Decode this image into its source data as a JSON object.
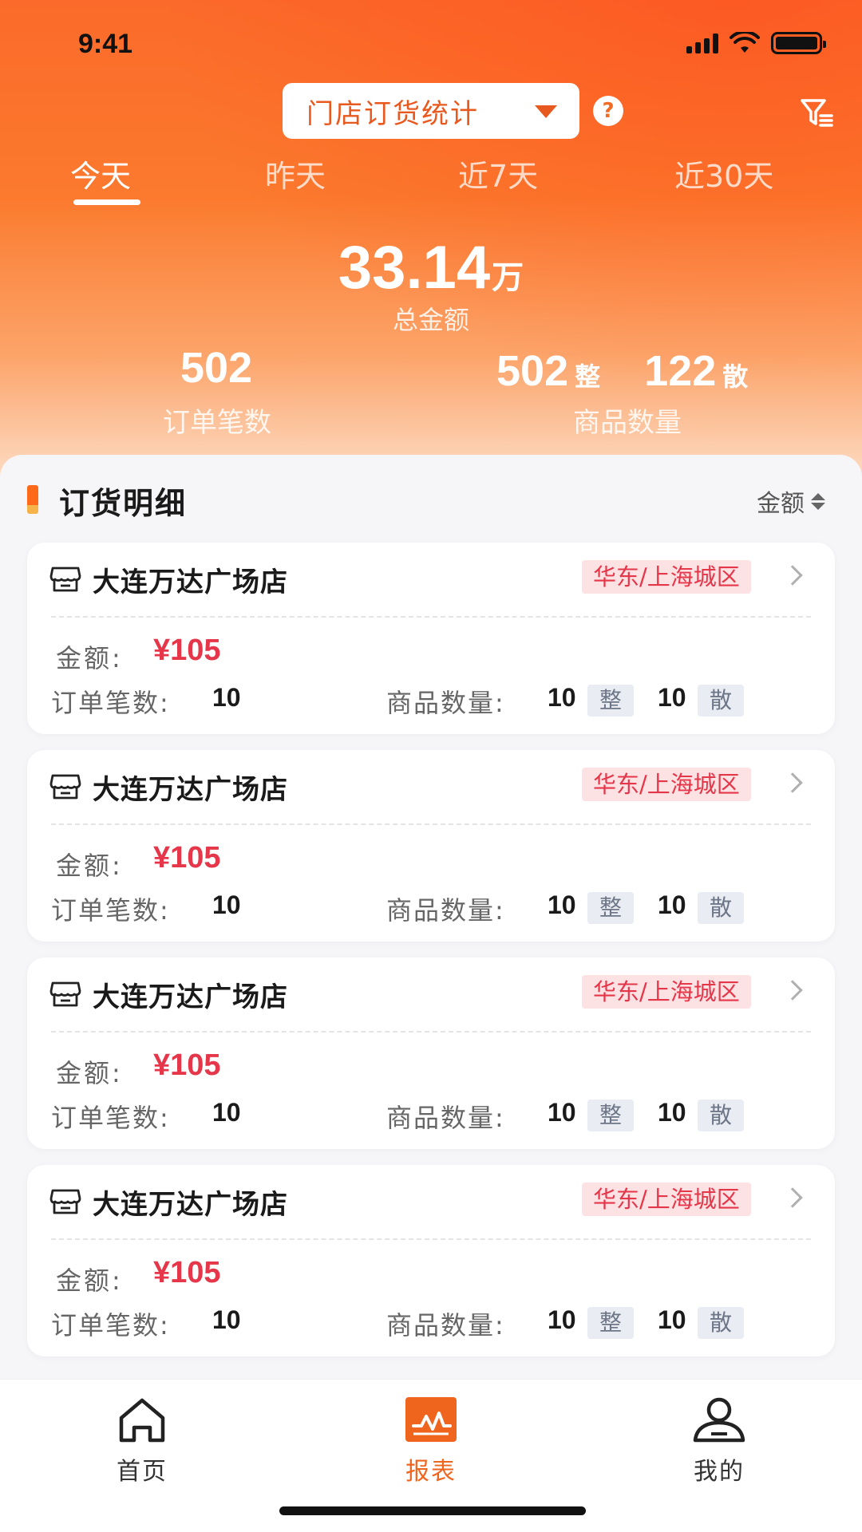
{
  "status_bar": {
    "time": "9:41"
  },
  "header": {
    "selector_label": "门店订货统计",
    "help_symbol": "?",
    "icons": {
      "help": "help-icon",
      "filter": "filter-icon",
      "dropdown": "caret-down-icon"
    }
  },
  "tabs": [
    {
      "label": "今天",
      "active": true
    },
    {
      "label": "昨天",
      "active": false
    },
    {
      "label": "近7天",
      "active": false
    },
    {
      "label": "近30天",
      "active": false
    }
  ],
  "summary": {
    "total_amount": "33.14",
    "total_unit": "万",
    "total_label": "总金额",
    "order_count": "502",
    "order_label": "订单笔数",
    "whole_qty": "502",
    "whole_unit": "整",
    "loose_qty": "122",
    "loose_unit": "散",
    "qty_label": "商品数量"
  },
  "detail": {
    "title": "订货明细",
    "sort_label": "金额",
    "cards": [
      {
        "store": "大连万达广场店",
        "region": "华东/上海城区",
        "amount_label": "金额:",
        "amount": "¥105",
        "orders_label": "订单笔数:",
        "orders": "10",
        "qty_label": "商品数量:",
        "whole": "10",
        "whole_unit": "整",
        "loose": "10",
        "loose_unit": "散"
      },
      {
        "store": "大连万达广场店",
        "region": "华东/上海城区",
        "amount_label": "金额:",
        "amount": "¥105",
        "orders_label": "订单笔数:",
        "orders": "10",
        "qty_label": "商品数量:",
        "whole": "10",
        "whole_unit": "整",
        "loose": "10",
        "loose_unit": "散"
      },
      {
        "store": "大连万达广场店",
        "region": "华东/上海城区",
        "amount_label": "金额:",
        "amount": "¥105",
        "orders_label": "订单笔数:",
        "orders": "10",
        "qty_label": "商品数量:",
        "whole": "10",
        "whole_unit": "整",
        "loose": "10",
        "loose_unit": "散"
      },
      {
        "store": "大连万达广场店",
        "region": "华东/上海城区",
        "amount_label": "金额:",
        "amount": "¥105",
        "orders_label": "订单笔数:",
        "orders": "10",
        "qty_label": "商品数量:",
        "whole": "10",
        "whole_unit": "整",
        "loose": "10",
        "loose_unit": "散"
      }
    ]
  },
  "tabbar": [
    {
      "label": "首页",
      "icon": "home-icon",
      "active": false
    },
    {
      "label": "报表",
      "icon": "report-icon",
      "active": true
    },
    {
      "label": "我的",
      "icon": "profile-icon",
      "active": false
    }
  ],
  "colors": {
    "accent": "#f0651e",
    "price": "#e5364a",
    "tag_bg": "#fde2e4"
  }
}
